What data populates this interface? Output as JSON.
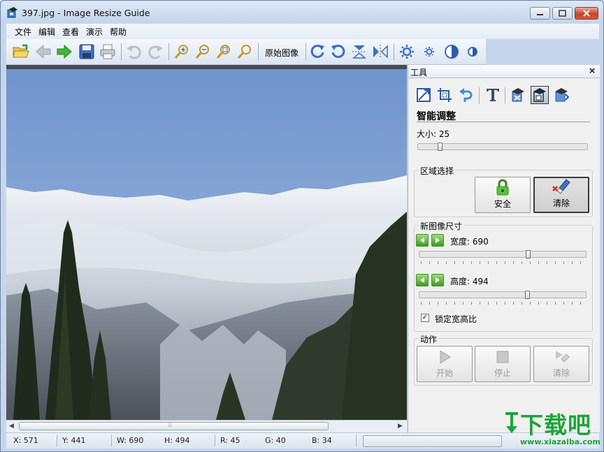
{
  "window": {
    "title": "397.jpg - Image Resize Guide"
  },
  "menu": [
    "文件",
    "编辑",
    "查看",
    "演示",
    "帮助"
  ],
  "toolbar": {
    "original_image_label": "原始图像"
  },
  "tools_panel": {
    "title": "工具",
    "close": "×",
    "section_title": "智能调整",
    "size_label": "大小: 25",
    "size_value": 25,
    "region": {
      "title": "区域选择",
      "safe_label": "安全",
      "clear_label": "清除"
    },
    "new_size": {
      "title": "新图像尺寸",
      "width_label": "宽度: 690",
      "height_label": "高度: 494",
      "lock_label": "锁定宽高比",
      "lock_checked": "✓"
    },
    "action": {
      "title": "动作",
      "start_label": "开始",
      "stop_label": "停止",
      "clear_label": "清除"
    }
  },
  "scrollbar": {
    "grip": "⦙⦙⦙"
  },
  "status": {
    "x": "X: 571",
    "y": "Y: 441",
    "w": "W: 690",
    "h": "H: 494",
    "r": "R: 45",
    "g": "G: 40",
    "b": "B: 34"
  },
  "watermark": {
    "text": "下载吧",
    "url": "www.xiazaiba.com"
  },
  "colors": {
    "accent_green": "#1ea43a",
    "sky": "#8fb0db"
  }
}
